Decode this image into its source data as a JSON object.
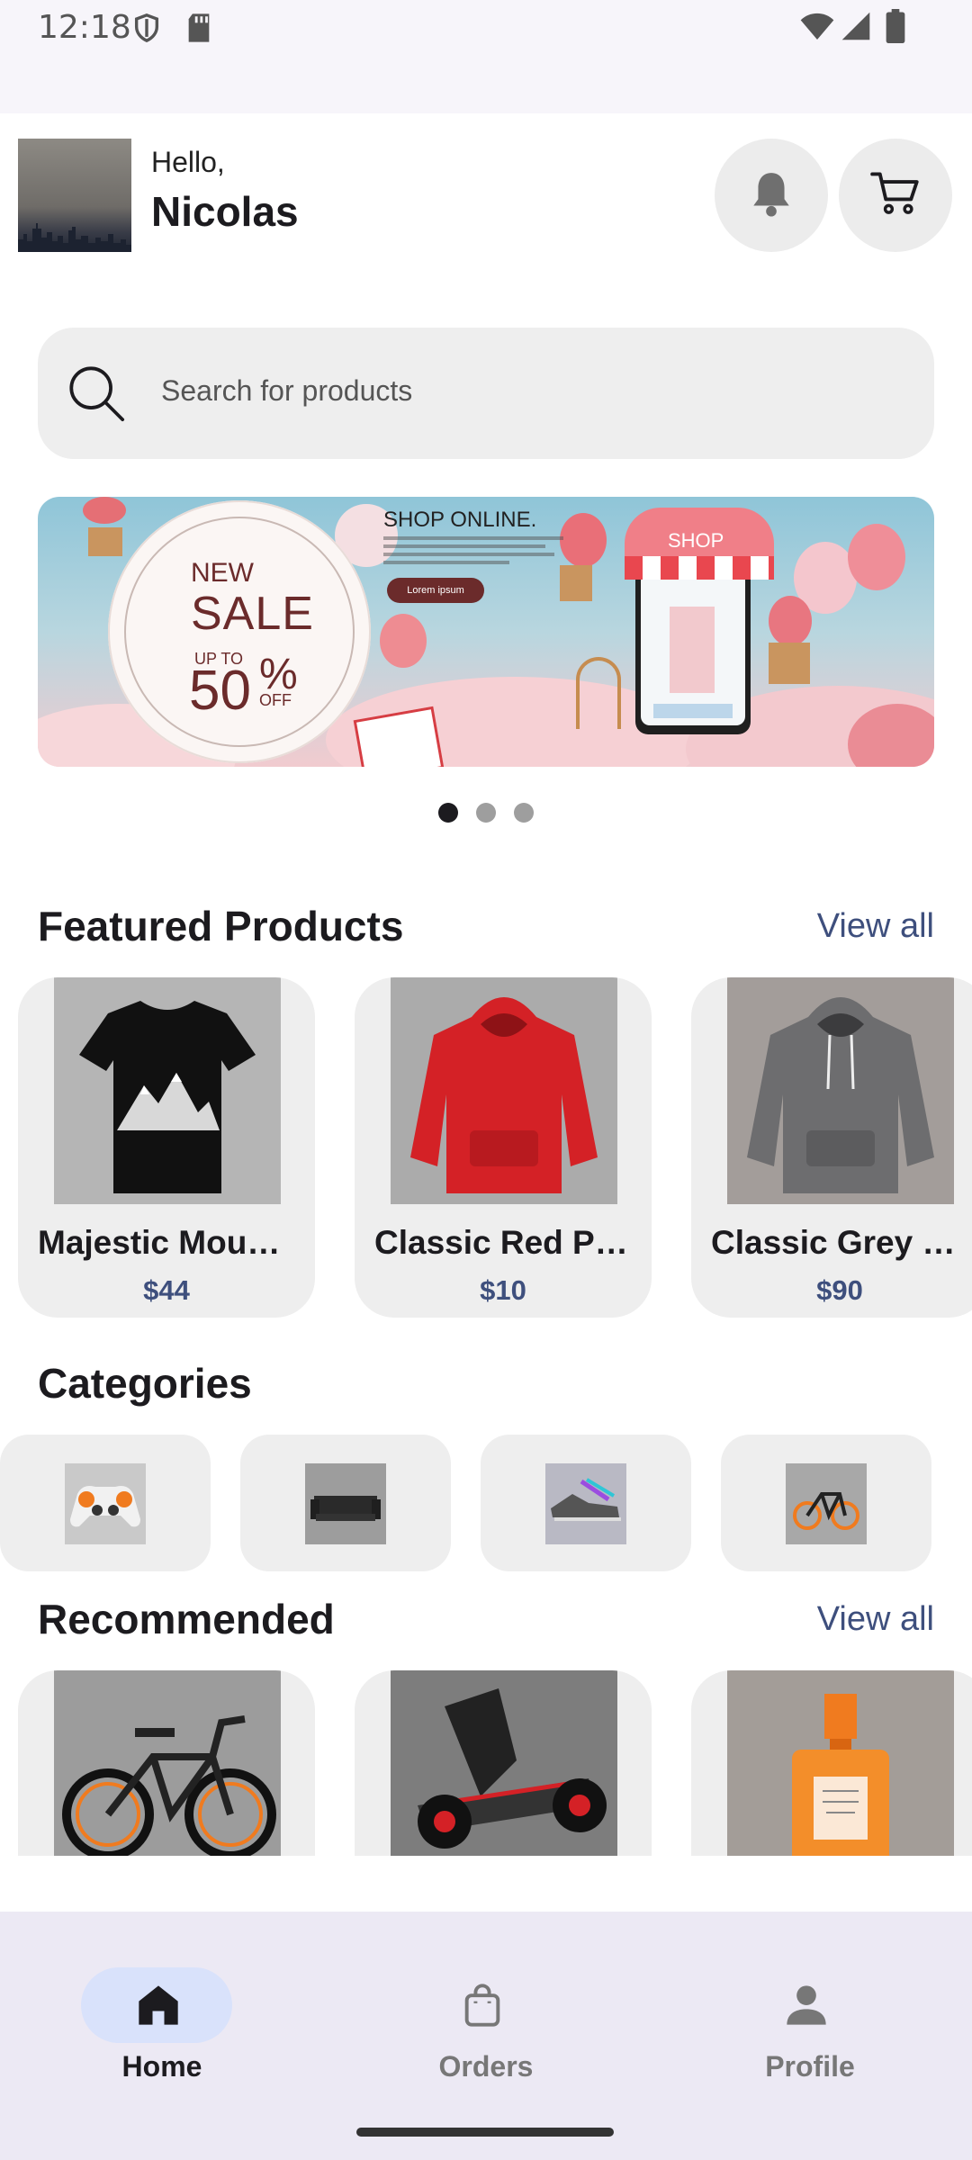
{
  "status_bar": {
    "time": "12:18"
  },
  "header": {
    "greeting": "Hello,",
    "username": "Nicolas"
  },
  "search": {
    "placeholder": "Search for products"
  },
  "banner": {
    "shop_online": "SHOP ONLINE.",
    "new": "NEW",
    "sale": "SALE",
    "up_to": "UP TO",
    "amount": "50",
    "percent": "%",
    "off": "OFF",
    "button_label": "Lorem ipsum",
    "shop_sign": "SHOP",
    "pagination_active": 1,
    "pagination_count": 3
  },
  "featured": {
    "title": "Featured Products",
    "view_all": "View all",
    "products": [
      {
        "name": "Majestic Mou…",
        "price": "$44",
        "image": "black mountain t-shirt"
      },
      {
        "name": "Classic Red P…",
        "price": "$10",
        "image": "red hoodie"
      },
      {
        "name": "Classic Grey …",
        "price": "$90",
        "image": "grey hoodie"
      }
    ]
  },
  "categories": {
    "title": "Categories",
    "items": [
      {
        "image": "game controller"
      },
      {
        "image": "sofa"
      },
      {
        "image": "sneakers"
      },
      {
        "image": "bicycle"
      }
    ]
  },
  "recommended": {
    "title": "Recommended",
    "view_all": "View all",
    "products": [
      {
        "image": "electric bike"
      },
      {
        "image": "go-kart"
      },
      {
        "image": "perfume bottle"
      }
    ]
  },
  "bottom_nav": {
    "items": [
      {
        "label": "Home",
        "icon": "home-icon",
        "active": true
      },
      {
        "label": "Orders",
        "icon": "bag-icon",
        "active": false
      },
      {
        "label": "Profile",
        "icon": "person-icon",
        "active": false
      }
    ]
  },
  "colors": {
    "accent": "#3e4f7d",
    "active_pill": "#d9e2fb",
    "nav_bg": "#ece9f4"
  }
}
